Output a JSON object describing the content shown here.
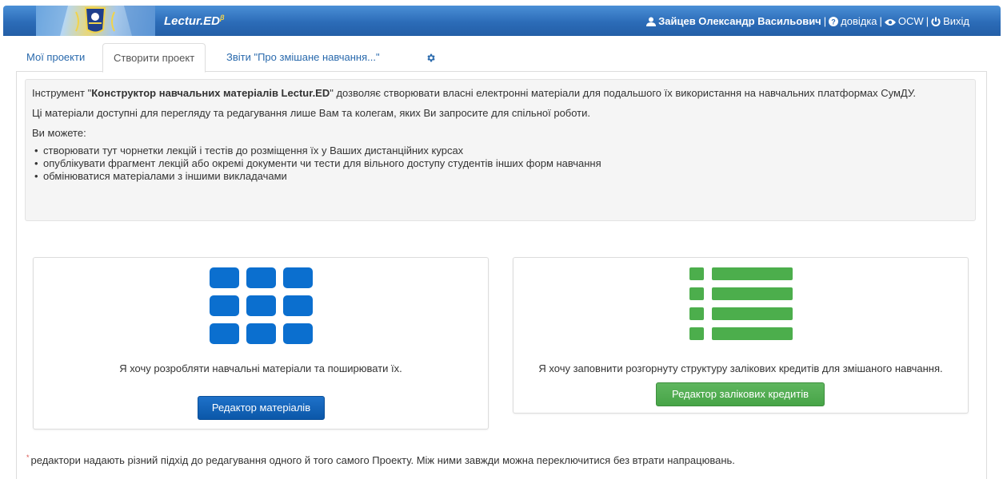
{
  "navbar": {
    "brand": "Lectur.ED",
    "brand_sup": "β",
    "user_name": "Зайцев Олександр Васильович",
    "help_label": "довідка",
    "ocw_label": "OCW",
    "logout_label": "Вихід",
    "separator": "|"
  },
  "tabs": [
    {
      "label": "Мої проекти",
      "active": false
    },
    {
      "label": "Створити проект",
      "active": true
    },
    {
      "label": "Звіти \"Про змішане навчання...\"",
      "active": false
    }
  ],
  "info": {
    "intro_prefix": "Інструмент \"",
    "intro_bold": "Конструктор навчальних матеріалів Lectur.ED",
    "intro_suffix": "\" дозволяє створювати власні електронні матеріали для подальшого їх використання на навчальних платформах СумДУ.",
    "access_text": "Ці матеріали доступні для перегляду та редагування лише Вам та колегам, яких Ви запросите для спільної роботи.",
    "can_text": "Ви можете:",
    "items": [
      "створювати тут чорнетки лекцій і тестів до розміщення їх у Ваших дистанційних курсах",
      "опублікувати фрагмент лекцій або окремі документи чи тести для вільного доступу студентів інших форм навчання",
      "обмінюватися матеріалами з іншими викладачами"
    ]
  },
  "cards": {
    "materials": {
      "icon": "th-grid-icon",
      "text": "Я хочу розробляти навчальні матеріали та поширювати їх.",
      "button": "Редактор матеріалів"
    },
    "credits": {
      "icon": "th-list-icon",
      "text": "Я хочу заповнити розгорнуту структуру залікових кредитів для змішаного навчання.",
      "button": "Редактор залікових кредитів"
    }
  },
  "footnote": {
    "star": "*",
    "text": "редактори надають різний підхід до редагування одного й того самого Проекту. Між ними завжди можна переключитися без втрати напрацювань."
  },
  "colors": {
    "navbar": "#2c6cb8",
    "grid_icon": "#0b6fcf",
    "list_icon": "#4cae4c",
    "primary_button": "#0b57a8",
    "success_button": "#47a447",
    "link": "#2a6aad"
  }
}
